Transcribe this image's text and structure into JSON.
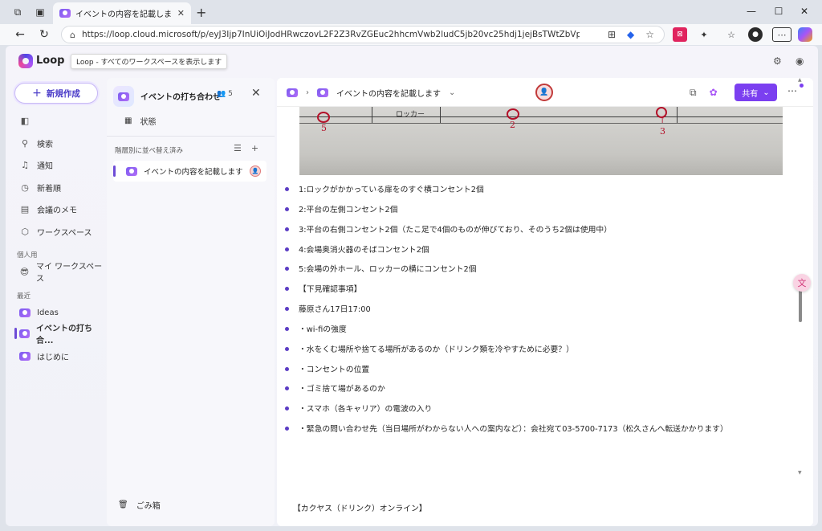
{
  "browser": {
    "tab_title": "イベントの内容を記載します",
    "url": "https://loop.cloud.microsoft/p/eyJ3Ijp7InUiOiJodHRwczovL2F2Z3RvZGEuc2hhcmVwb2ludC5jb20vc25hdj1jejBsTWtZbVpEMWlJWE5SZDFad01sVkd..."
  },
  "app": {
    "name": "Loop",
    "tooltip": "Loop - すべてのワークスペースを表示します"
  },
  "leftnav": {
    "new_button": "新規作成",
    "items": [
      {
        "label": "検索"
      },
      {
        "label": "通知"
      },
      {
        "label": "新着順"
      },
      {
        "label": "会議のメモ"
      },
      {
        "label": "ワークスペース"
      }
    ],
    "personal_section": "個人用",
    "personal_items": [
      {
        "label": "マイ ワークスペース"
      }
    ],
    "recent_section": "最近",
    "recent_items": [
      {
        "label": "Ideas"
      },
      {
        "label": "イベントの打ち合..."
      },
      {
        "label": "はじめに"
      }
    ]
  },
  "workspace_panel": {
    "title": "イベントの打ち合わせ",
    "member_count": "5",
    "status_label": "状態",
    "sort_label": "階層別に並べ替え済み",
    "page_title": "イベントの内容を記載します",
    "trash_label": "ごみ箱"
  },
  "doc": {
    "breadcrumb_title": "イベントの内容を記載します",
    "share_label": "共有",
    "image": {
      "sketch_label": "ロッカー",
      "marks": [
        "5",
        "2",
        "3"
      ]
    },
    "list_items": [
      "1:ロックがかかっている扉をのすぐ横コンセント2個",
      "2:平台の左側コンセント2個",
      "3:平台の右側コンセント2個（たこ足で4個のものが伸びており、そのうち2個は使用中）",
      "4:会場奥消火器のそばコンセント2個",
      "5:会場の外ホール、ロッカーの横にコンセント2個",
      "【下見確認事項】",
      "藤原さん17日17:00",
      "・wi-fiの強度",
      "・水をくむ場所や捨てる場所があるのか（ドリンク類を冷やすために必要？）",
      "・コンセントの位置",
      "・ゴミ捨て場があるのか",
      "・スマホ（各キャリア）の電波の入り",
      "・緊急の問い合わせ先（当日場所がわからない人への案内など）：会社宛て03-5700-7173（松久さんへ転送かかります）"
    ],
    "footer_line": "【カクヤス（ドリンク）オンライン】"
  },
  "colors": {
    "accent": "#7b3ff0",
    "bullet": "#5b3cc4",
    "avatar_red": "#c13a3a"
  }
}
